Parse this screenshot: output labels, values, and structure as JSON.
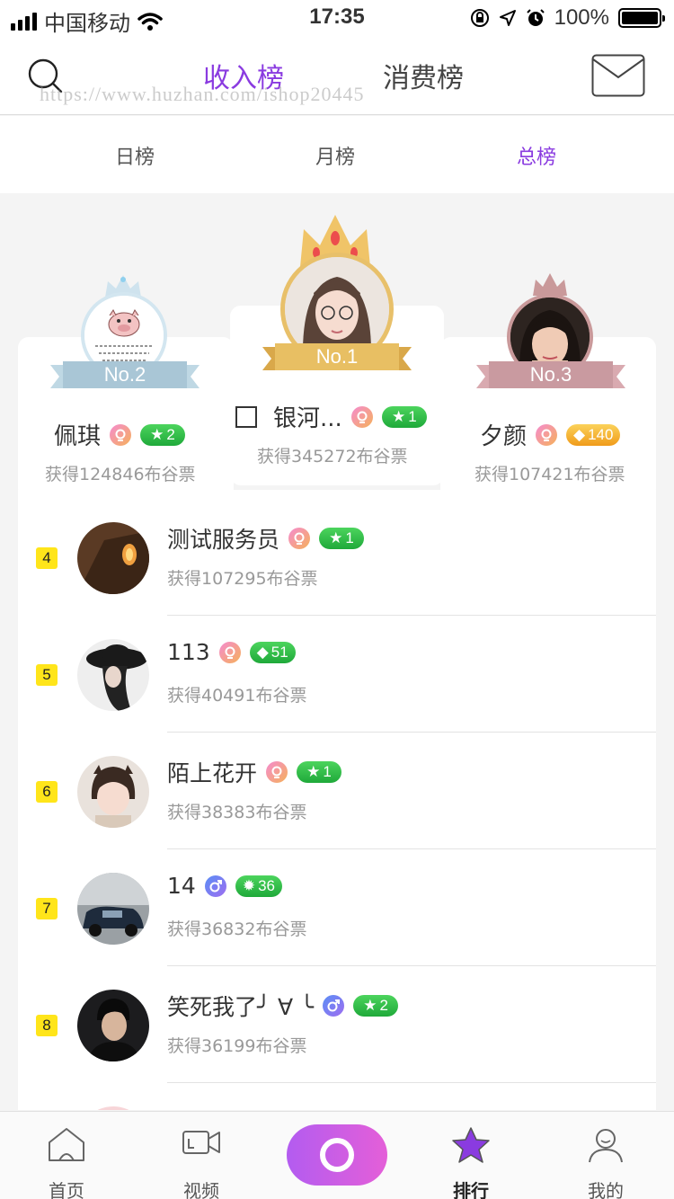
{
  "status_bar": {
    "carrier": "中国移动",
    "time": "17:35",
    "battery": "100%"
  },
  "header": {
    "tabs": [
      "收入榜",
      "消费榜"
    ],
    "active_tab": "收入榜",
    "watermark": "https://www.huzhan.com/ishop20445"
  },
  "subtabs": {
    "items": [
      "日榜",
      "月榜",
      "总榜"
    ],
    "active": "总榜"
  },
  "podium": [
    {
      "rank_label": "No.1",
      "name": "银河...",
      "gender": "female",
      "level": "1",
      "level_icon": "star",
      "votes": "获得345272布谷票"
    },
    {
      "rank_label": "No.2",
      "name": "佩琪",
      "gender": "female",
      "level": "2",
      "level_icon": "star",
      "votes": "获得124846布谷票"
    },
    {
      "rank_label": "No.3",
      "name": "夕颜",
      "gender": "female",
      "level": "140",
      "level_icon": "diamond",
      "votes": "获得107421布谷票"
    }
  ],
  "list": [
    {
      "rank": "4",
      "name": "测试服务员",
      "gender": "female",
      "level": "1",
      "level_icon": "star",
      "level_color": "green",
      "votes": "获得107295布谷票"
    },
    {
      "rank": "5",
      "name": "113",
      "gender": "female",
      "level": "51",
      "level_icon": "diamond",
      "level_color": "green",
      "votes": "获得40491布谷票"
    },
    {
      "rank": "6",
      "name": "陌上花开",
      "gender": "female",
      "level": "1",
      "level_icon": "star",
      "level_color": "green",
      "votes": "获得38383布谷票"
    },
    {
      "rank": "7",
      "name": "14",
      "gender": "male",
      "level": "36",
      "level_icon": "sun",
      "level_color": "green",
      "votes": "获得36832布谷票"
    },
    {
      "rank": "8",
      "name": "笑死我了╯ ∀ ╰",
      "gender": "male",
      "level": "2",
      "level_icon": "star",
      "level_color": "green",
      "votes": "获得36199布谷票"
    }
  ],
  "tabbar": {
    "items": [
      "首页",
      "视频",
      "排行",
      "我的"
    ],
    "active": "排行"
  },
  "colors": {
    "accent": "#8a3be0",
    "rank_badge": "#ffe51a",
    "level_green": "#2bb845",
    "level_gold": "#f5b52e"
  }
}
